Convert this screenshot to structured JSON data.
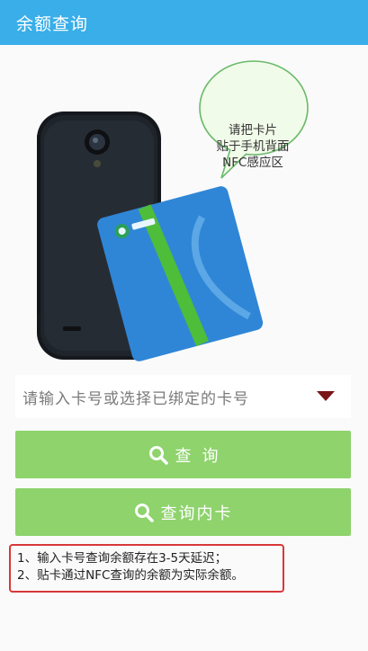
{
  "header": {
    "title": "余额查询"
  },
  "hero": {
    "bubble_lines": [
      "请把卡片",
      "贴于手机背面",
      "NFC感应区"
    ]
  },
  "card_input": {
    "placeholder": "请输入卡号或选择已绑定的卡号"
  },
  "buttons": {
    "query": "查询",
    "query_inner": "查询内卡"
  },
  "notes": [
    "1、输入卡号查询余额存在3-5天延迟；",
    "2、贴卡通过NFC查询的余额为实际余额。"
  ],
  "colors": {
    "titlebar": "#39aee8",
    "button": "#8ed36c",
    "notice_border": "#d83838",
    "caret": "#7a1616"
  }
}
